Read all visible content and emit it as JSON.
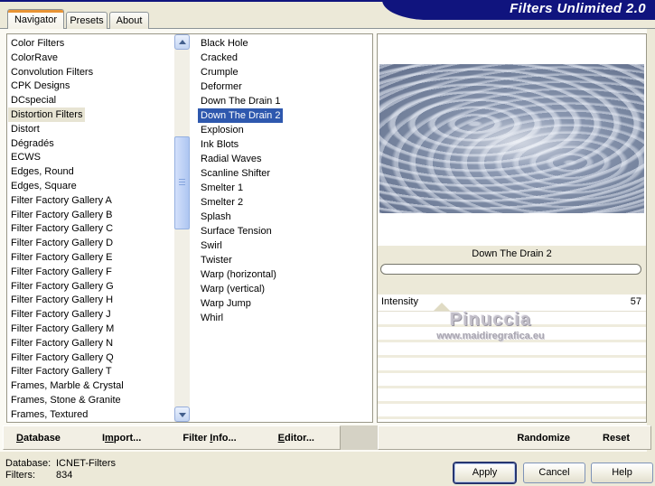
{
  "window": {
    "title": "Filters Unlimited 2.0",
    "colors": {
      "navy": "#10147E",
      "dialog_tan": "#ECE9D8",
      "tab_accent_orange": "#E89435",
      "selection_blue": "#2E58AE",
      "preview_base": "#76849E"
    }
  },
  "tabs": [
    {
      "label": "Navigator",
      "active": true
    },
    {
      "label": "Presets",
      "active": false
    },
    {
      "label": "About",
      "active": false
    }
  ],
  "categories": {
    "selected": "Distortion Filters",
    "items": [
      "Color Filters",
      "ColorRave",
      "Convolution Filters",
      "CPK Designs",
      "DCspecial",
      "Distortion Filters",
      "Distort",
      "Dégradés",
      "ECWS",
      "Edges, Round",
      "Edges, Square",
      "Filter Factory Gallery A",
      "Filter Factory Gallery B",
      "Filter Factory Gallery C",
      "Filter Factory Gallery D",
      "Filter Factory Gallery E",
      "Filter Factory Gallery F",
      "Filter Factory Gallery G",
      "Filter Factory Gallery H",
      "Filter Factory Gallery J",
      "Filter Factory Gallery M",
      "Filter Factory Gallery N",
      "Filter Factory Gallery Q",
      "Filter Factory Gallery T",
      "Frames, Marble & Crystal",
      "Frames, Stone & Granite",
      "Frames, Textured"
    ]
  },
  "filters": {
    "selected": "Down The Drain 2",
    "items": [
      "Black Hole",
      "Cracked",
      "Crumple",
      "Deformer",
      "Down The Drain 1",
      "Down The Drain 2",
      "Explosion",
      "Ink Blots",
      "Radial Waves",
      "Scanline Shifter",
      "Smelter 1",
      "Smelter 2",
      "Splash",
      "Surface Tension",
      "Swirl",
      "Twister",
      "Warp (horizontal)",
      "Warp (vertical)",
      "Warp Jump",
      "Whirl"
    ]
  },
  "preview": {
    "caption": "Down The Drain 2"
  },
  "intensity": {
    "label": "Intensity",
    "value": "57",
    "max": 255
  },
  "watermark": {
    "name": "Pinuccia",
    "url": "www.maidiregrafica.eu"
  },
  "toolbar": {
    "left": [
      {
        "label": "Database",
        "u": 0
      },
      {
        "label": "Import...",
        "u": 1
      },
      {
        "label": "Filter Info...",
        "u": 7
      },
      {
        "label": "Editor...",
        "u": 0
      }
    ],
    "right": [
      {
        "label": "Randomize"
      },
      {
        "label": "Reset"
      }
    ]
  },
  "status": {
    "database_label": "Database:",
    "database_value": "ICNET-Filters",
    "filters_label": "Filters:",
    "filters_value": "834"
  },
  "action_buttons": [
    {
      "label": "Apply",
      "default": true
    },
    {
      "label": "Cancel",
      "default": false
    },
    {
      "label": "Help",
      "default": false
    }
  ]
}
